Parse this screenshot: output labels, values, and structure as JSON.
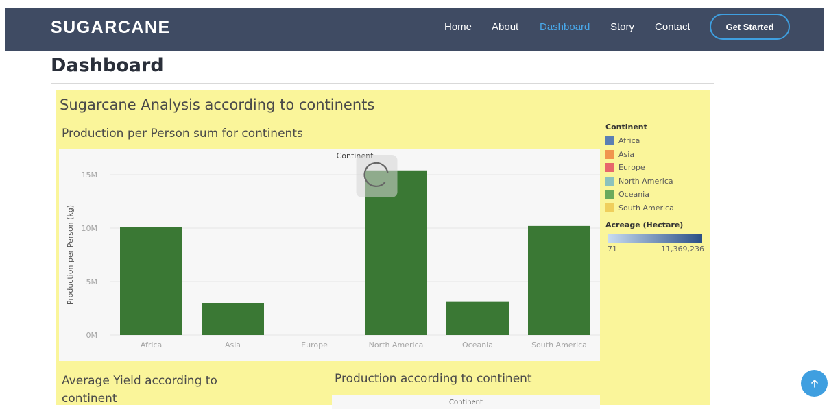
{
  "header": {
    "brand": "SUGARCANE",
    "nav": [
      "Home",
      "About",
      "Dashboard",
      "Story",
      "Contact"
    ],
    "active": "Dashboard",
    "cta": "Get Started",
    "colors": {
      "bar": "#3f4b63",
      "accent": "#49a8ea"
    }
  },
  "page": {
    "title": "Dashboard"
  },
  "dashboard": {
    "title": "Sugarcane Analysis according to continents",
    "sheet1_title": "Production per Person sum for continents",
    "sheet2_title": "Average Yield according to continent",
    "sheet3_title": "Production according to continent",
    "sheet3_header": "Continent",
    "background": "#faf59a"
  },
  "legend": {
    "continent_title": "Continent",
    "items": [
      {
        "label": "Africa",
        "color": "#5b7fb3"
      },
      {
        "label": "Asia",
        "color": "#f0954d"
      },
      {
        "label": "Europe",
        "color": "#e7676b"
      },
      {
        "label": "North America",
        "color": "#8cc2bd"
      },
      {
        "label": "Oceania",
        "color": "#6aaa5c"
      },
      {
        "label": "South America",
        "color": "#efcf5c"
      }
    ],
    "acreage_title": "Acreage (Hectare)",
    "acreage_min": "71",
    "acreage_max": "11,369,236"
  },
  "chart_data": {
    "type": "bar",
    "title": "Production per Person sum for continents",
    "header": "Continent",
    "categories": [
      "Africa",
      "Asia",
      "Europe",
      "North America",
      "Oceania",
      "South America"
    ],
    "values": [
      10100000,
      3000000,
      0,
      15400000,
      3100000,
      10200000
    ],
    "ylabel": "Production per Person (kg)",
    "yticks": [
      "0M",
      "5M",
      "10M",
      "15M"
    ],
    "ytick_values": [
      0,
      5000000,
      10000000,
      15000000
    ],
    "ylim": [
      0,
      15000000
    ],
    "bar_color": "#3a7834",
    "loading": true
  }
}
